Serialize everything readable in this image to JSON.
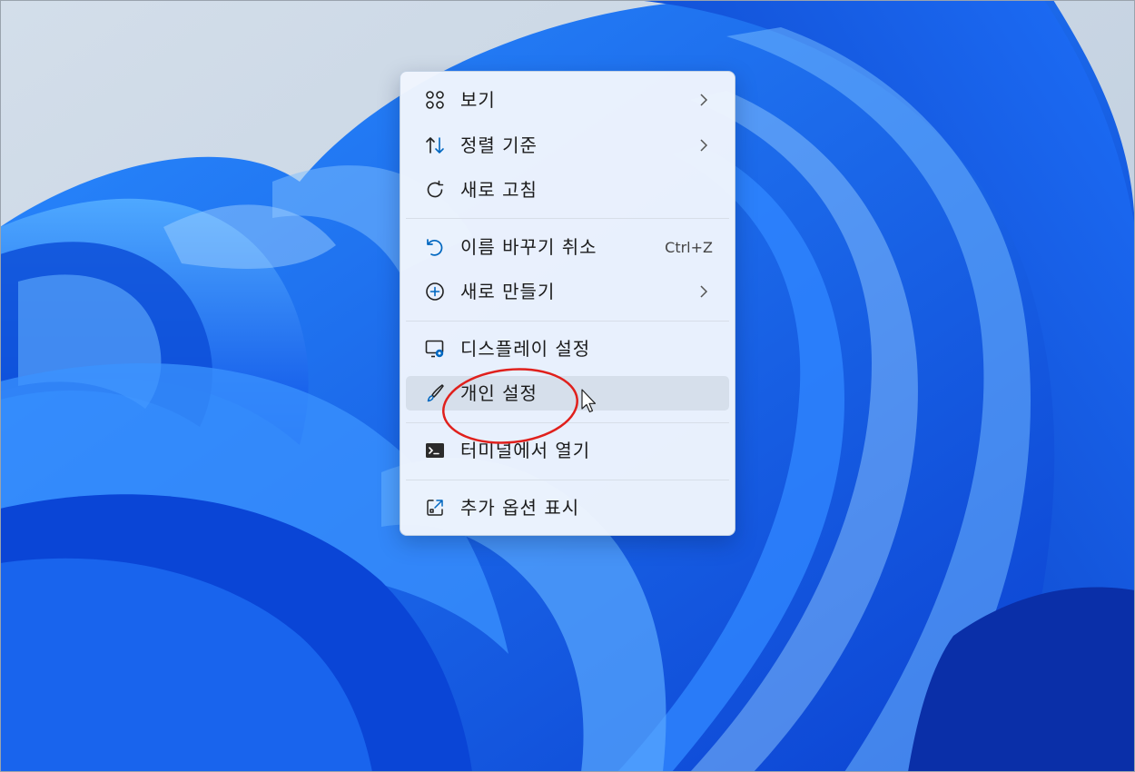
{
  "context_menu": {
    "items": [
      {
        "label": "보기",
        "icon": "grid-icon",
        "submenu": true
      },
      {
        "label": "정렬 기준",
        "icon": "sort-arrows-icon",
        "submenu": true
      },
      {
        "label": "새로 고침",
        "icon": "refresh-icon",
        "submenu": false
      },
      {
        "label": "이름 바꾸기 취소",
        "icon": "undo-icon",
        "shortcut": "Ctrl+Z",
        "submenu": false
      },
      {
        "label": "새로 만들기",
        "icon": "plus-circle-icon",
        "submenu": true
      },
      {
        "label": "디스플레이 설정",
        "icon": "display-settings-icon",
        "submenu": false
      },
      {
        "label": "개인 설정",
        "icon": "brush-icon",
        "submenu": false,
        "hovered": true,
        "annotated": true
      },
      {
        "label": "터미널에서 열기",
        "icon": "terminal-icon",
        "submenu": false
      },
      {
        "label": "추가 옵션 표시",
        "icon": "more-options-icon",
        "submenu": false
      }
    ]
  },
  "annotation": {
    "type": "red-ellipse",
    "target": "개인 설정",
    "color": "#e0201c"
  },
  "colors": {
    "accent": "#0067c0",
    "menu_background": "#f0f5fd",
    "wallpaper_blue": "#0b5cf0"
  }
}
